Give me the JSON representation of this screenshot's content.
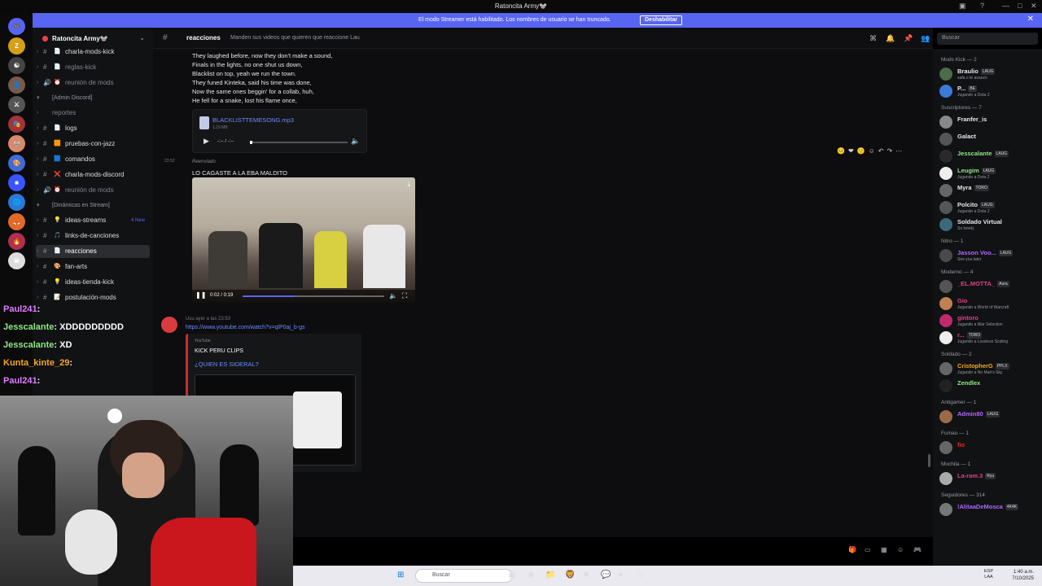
{
  "window": {
    "title": "Ratoncita Army🐭"
  },
  "banner": {
    "message": "El modo Streamer está habilitado. Los nombres de usuario se han truncado.",
    "button": "Deshabilitar"
  },
  "servers": [
    {
      "label": "🎮",
      "color": "#5865f2",
      "badge": "164"
    },
    {
      "label": "Z",
      "color": "#d4a017",
      "badge": ""
    },
    {
      "label": "☯",
      "color": "#444",
      "badge": ""
    },
    {
      "label": "👤",
      "color": "#7a5a4a",
      "badge": "118"
    },
    {
      "label": "⚔",
      "color": "#555",
      "badge": "384"
    },
    {
      "label": "🎭",
      "color": "#a0343a",
      "badge": ""
    },
    {
      "label": "🐭",
      "color": "#d88a6a",
      "badge": ""
    },
    {
      "label": "🎨",
      "color": "#3f6ad8",
      "badge": ""
    },
    {
      "label": "■",
      "color": "#3a55ff",
      "badge": ""
    },
    {
      "label": "🌐",
      "color": "#2a7ad8",
      "badge": "45"
    },
    {
      "label": "🦊",
      "color": "#e16a2a",
      "badge": "79"
    },
    {
      "label": "🔥",
      "color": "#b03050",
      "badge": "306"
    },
    {
      "label": "☠",
      "color": "#ddd",
      "badge": ""
    }
  ],
  "sidebar": {
    "server_name": "Ratoncita Army🐭",
    "channels": [
      {
        "name": "charla-mods-kick",
        "emoji": "📄",
        "type": "text",
        "muted": false
      },
      {
        "name": "reglas-kick",
        "emoji": "📄",
        "type": "text",
        "muted": true
      },
      {
        "name": "reunión de mods",
        "emoji": "⏰",
        "type": "voice",
        "muted": true
      },
      {
        "name": "[Admin Discord]",
        "type": "category"
      },
      {
        "name": "reportes",
        "type": "plain",
        "muted": true
      },
      {
        "name": "logs",
        "emoji": "📄",
        "type": "text",
        "muted": false
      },
      {
        "name": "pruebas-con-jazz",
        "emoji": "🟧",
        "type": "text",
        "muted": false
      },
      {
        "name": "comandos",
        "emoji": "🟦",
        "type": "text",
        "muted": false
      },
      {
        "name": "charla-mods-discord",
        "emoji": "❌",
        "type": "text",
        "muted": false
      },
      {
        "name": "reunión de mods",
        "emoji": "⏰",
        "type": "voice",
        "muted": true
      },
      {
        "name": "[Dinámicas en Stream]",
        "type": "category"
      },
      {
        "name": "ideas-streams",
        "emoji": "💡",
        "type": "text",
        "muted": false,
        "new": "4 New"
      },
      {
        "name": "links-de-canciones",
        "emoji": "🎵",
        "type": "text",
        "muted": false
      },
      {
        "name": "reacciones",
        "emoji": "📄",
        "type": "text",
        "muted": false,
        "active": true
      },
      {
        "name": "fan-arts",
        "emoji": "🎨",
        "type": "text",
        "muted": false
      },
      {
        "name": "ideas-tienda-kick",
        "emoji": "💡",
        "type": "text",
        "muted": false
      },
      {
        "name": "postulación-mods",
        "emoji": "📝",
        "type": "text",
        "muted": false
      }
    ]
  },
  "chat_header": {
    "channel": "reacciones",
    "topic": "Manden sus videos que quieren que reaccione Lau",
    "search_placeholder": "Buscar"
  },
  "messages": {
    "lyrics": [
      "They laughed before, now they don't make a sound,",
      "Finals in the lights, no one shut us down,",
      "Blacklist on top, yeah we run the town.",
      "They funed Kinteka, said his time was done,",
      "Now the same ones beggin' for a collab, huh,",
      "He fell for a snake, lost his flame once,"
    ],
    "attachment": {
      "filename": "BLACKLISTTEMESONG.mp3",
      "size": "1.29 MB",
      "time": "-:-- / -:--"
    },
    "forwarded": {
      "timestamp": "23:52",
      "label": "Reenviado",
      "text": "LO CAGASTE A LA EBA MALDITO",
      "video_time": "0:02 / 0:19",
      "progress": 0.37
    },
    "second": {
      "user": "Usu",
      "time": "ayer a las 23:53",
      "link": "https://www.youtube.com/watch?v=qlP0aj_b-gs",
      "embed": {
        "provider": "YouTube",
        "author": "KICK PERU CLIPS",
        "title": "¿QUIEN ES SIDERAL?"
      }
    }
  },
  "members": {
    "groups": [
      {
        "name": "Mods Kick — 2",
        "members": [
          {
            "name": "Braulio",
            "tag": "LAUG",
            "activity": "safa o te avanzo",
            "color": "#e8e8e8",
            "av": "#4b6b4b"
          },
          {
            "name": "P...",
            "tag": "BE",
            "activity": "Jugando a Dota 2",
            "color": "#e8e8e8",
            "av": "#3a7ad8"
          }
        ]
      },
      {
        "name": "Suscriptores — 7",
        "members": [
          {
            "name": "Franfer_is",
            "tag": "",
            "activity": "",
            "color": "#e8e8e8",
            "av": "#888"
          },
          {
            "name": "Galact",
            "tag": "",
            "activity": "",
            "color": "#e8e8e8",
            "av": "#555"
          },
          {
            "name": "Jesscalante",
            "tag": "LAUG",
            "activity": "",
            "color": "#8ee884",
            "av": "#2a2a2a"
          },
          {
            "name": "Leugim",
            "tag": "LAUG",
            "activity": "Jugando a Dota 2",
            "color": "#8ee884",
            "av": "#eee"
          },
          {
            "name": "Myra",
            "tag": "TORO",
            "activity": "",
            "color": "#e8e8e8",
            "av": "#666"
          },
          {
            "name": "Polcito",
            "tag": "LAUG",
            "activity": "Jugando a Dota 2",
            "color": "#e8e8e8",
            "av": "#555"
          },
          {
            "name": "Soldado Virtual",
            "tag": "",
            "activity": "So lonely",
            "color": "#e8e8e8",
            "av": "#3a6a7a"
          }
        ]
      },
      {
        "name": "Nitro — 1",
        "members": [
          {
            "name": "Jasson Voo...",
            "tag": "LAUG",
            "activity": "See you later",
            "color": "#b066ff",
            "av": "#4a4a4a"
          }
        ]
      },
      {
        "name": "Moderno — 4",
        "members": [
          {
            "name": "_EL.MOTTA_",
            "tag": "Aura",
            "activity": "",
            "color": "#e0408a",
            "av": "#555"
          },
          {
            "name": "Gio",
            "tag": "",
            "activity": "Jugando a World of Warcraft",
            "color": "#e0408a",
            "av": "#c08050"
          },
          {
            "name": "gintoro",
            "tag": "",
            "activity": "Jugando a War Selection",
            "color": "#e0408a",
            "av": "#c02a6a"
          },
          {
            "name": "r...",
            "tag": "TORO",
            "activity": "Jugando a Lossless Scaling",
            "color": "#e0408a",
            "av": "#eee"
          }
        ]
      },
      {
        "name": "Soldado — 2",
        "members": [
          {
            "name": "CristopherG",
            "tag": "PPLX",
            "activity": "Jugando a No Man's Sky",
            "color": "#f5a623",
            "av": "#666"
          },
          {
            "name": "Zendlex",
            "tag": "",
            "activity": "",
            "color": "#8ee884",
            "av": "#222"
          }
        ]
      },
      {
        "name": "Antigamer — 1",
        "members": [
          {
            "name": "Admin80",
            "tag": "LAUG",
            "activity": "",
            "color": "#b066ff",
            "av": "#9a6a4a"
          }
        ]
      },
      {
        "name": "Fumao — 1",
        "members": [
          {
            "name": "fio",
            "tag": "",
            "activity": "",
            "color": "#e03030",
            "av": "#666"
          }
        ]
      },
      {
        "name": "Mochila — 1",
        "members": [
          {
            "name": "La-ram.3",
            "tag": "Ryu",
            "activity": "",
            "color": "#e0408a",
            "av": "#aaa"
          }
        ]
      },
      {
        "name": "Seguidores — 314",
        "members": [
          {
            "name": "!AlitaaDeMosca",
            "tag": "4K4K",
            "activity": "",
            "color": "#b066ff",
            "av": "#777"
          }
        ]
      }
    ]
  },
  "overlay_chat": [
    {
      "user": "Paul241",
      "text": ":",
      "color": "u"
    },
    {
      "user": "Jesscalante",
      "text": ": XDDDDDDDDD",
      "color": "u2"
    },
    {
      "user": "Jesscalante",
      "text": ": XD",
      "color": "u2"
    },
    {
      "user": "Kunta_kinte_29",
      "text": ":",
      "color": "u3"
    },
    {
      "user": "Paul241",
      "text": ":",
      "color": "u"
    }
  ],
  "taskbar": {
    "search": "Buscar",
    "lang": "ESP\nLAA",
    "time": "1:40 a.m.",
    "date": "7/10/2025"
  }
}
